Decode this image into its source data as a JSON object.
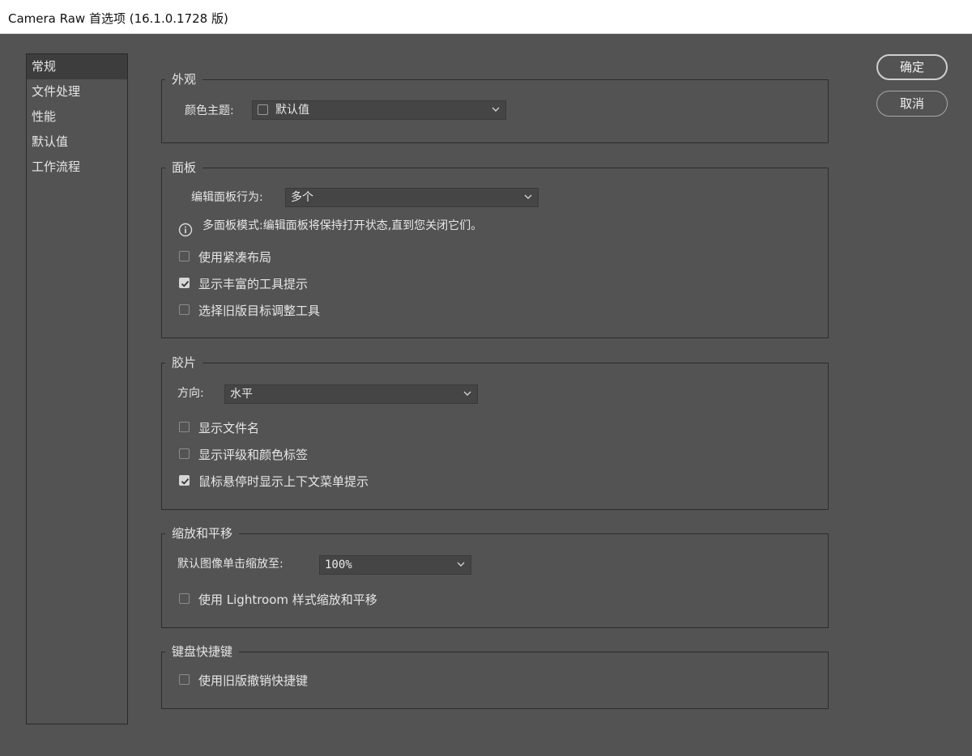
{
  "window": {
    "title": "Camera Raw 首选项 (16.1.0.1728 版)"
  },
  "sidebar": {
    "items": [
      {
        "label": "常规"
      },
      {
        "label": "文件处理"
      },
      {
        "label": "性能"
      },
      {
        "label": "默认值"
      },
      {
        "label": "工作流程"
      }
    ]
  },
  "buttons": {
    "ok": "确定",
    "cancel": "取消"
  },
  "appearance": {
    "group_label": "外观",
    "theme_label": "颜色主题:",
    "theme_value": "默认值"
  },
  "panels": {
    "group_label": "面板",
    "behavior_label": "编辑面板行为:",
    "behavior_value": "多个",
    "info_text": "多面板模式:编辑面板将保持打开状态,直到您关闭它们。",
    "options": [
      {
        "label": "使用紧凑布局",
        "checked": false
      },
      {
        "label": "显示丰富的工具提示",
        "checked": true
      },
      {
        "label": "选择旧版目标调整工具",
        "checked": false
      }
    ]
  },
  "filmstrip": {
    "group_label": "胶片",
    "orientation_label": "方向:",
    "orientation_value": "水平",
    "options": [
      {
        "label": "显示文件名",
        "checked": false
      },
      {
        "label": "显示评级和颜色标签",
        "checked": false
      },
      {
        "label": "鼠标悬停时显示上下文菜单提示",
        "checked": true
      }
    ]
  },
  "zoom": {
    "group_label": "缩放和平移",
    "default_label": "默认图像单击缩放至:",
    "default_value": "100%",
    "options": [
      {
        "label": "使用 Lightroom 样式缩放和平移",
        "checked": false
      }
    ]
  },
  "shortcuts": {
    "group_label": "键盘快捷键",
    "options": [
      {
        "label": "使用旧版撤销快捷键",
        "checked": false
      }
    ]
  }
}
